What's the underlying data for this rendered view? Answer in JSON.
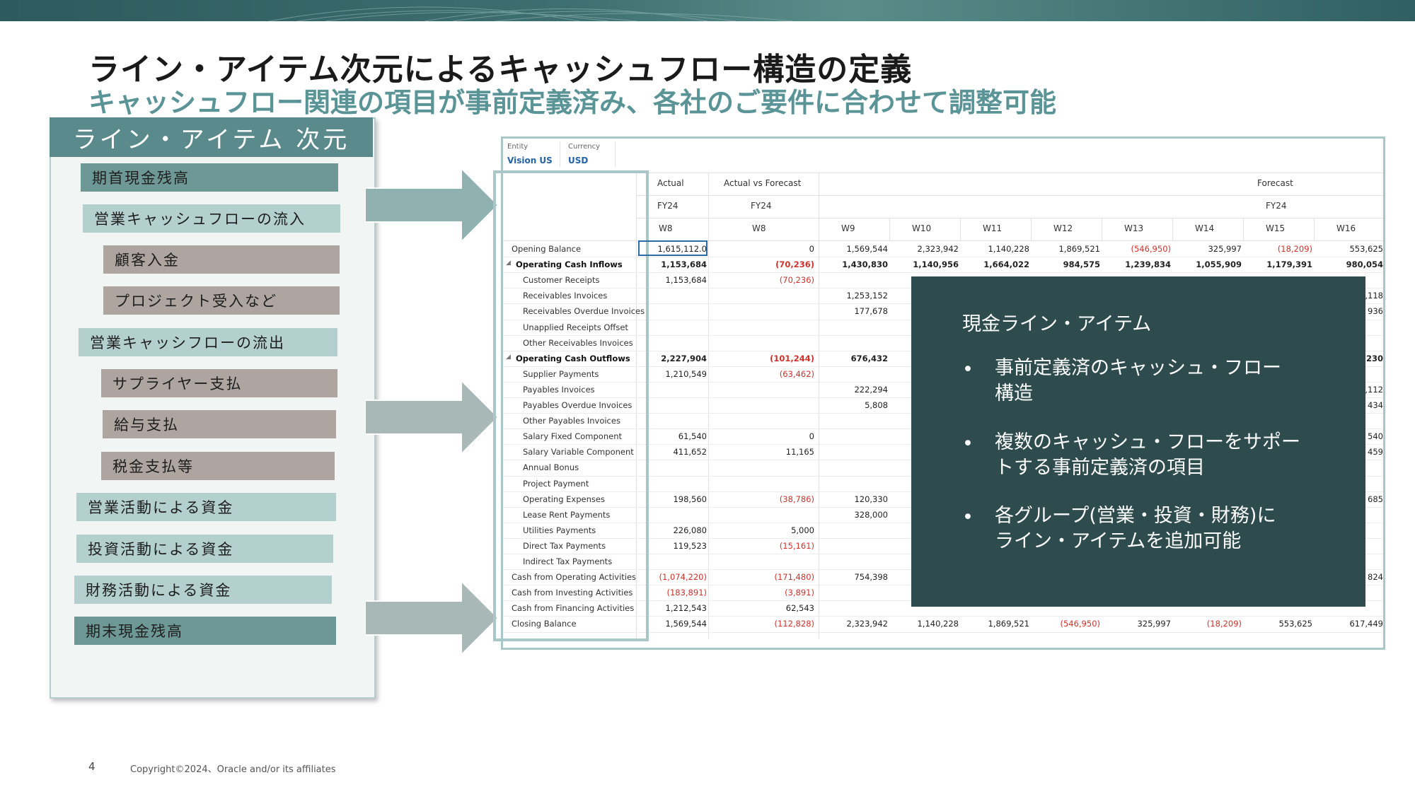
{
  "slide": {
    "title": "ライン・アイテム次元によるキャッシュフロー構造の定義",
    "subtitle": "キャッシュフロー関連の項目が事前定義済み、各社のご要件に合わせて調整可能",
    "page_number": "4",
    "copyright": "Copyright©2024、Oracle and/or its affiliates"
  },
  "left_panel": {
    "header": "ライン・アイテム 次元",
    "items": [
      "期首現金残高",
      "営業キャッシュフローの流入",
      "顧客入金",
      "プロジェクト受入など",
      "営業キャッシフローの流出",
      "サプライヤー支払",
      "給与支払",
      "税金支払等",
      "営業活動による資金",
      "投資活動による資金",
      "財務活動による資金",
      "期末現金残高"
    ]
  },
  "grid": {
    "pov": {
      "entity_label": "Entity",
      "entity_value": "Vision US",
      "currency_label": "Currency",
      "currency_value": "USD"
    },
    "header_row1": [
      "Actual",
      "Actual vs Forecast",
      "Forecast"
    ],
    "header_row2": [
      "FY24",
      "FY24",
      "FY24"
    ],
    "periods": [
      "W8",
      "W8",
      "W9",
      "W10",
      "W11",
      "W12",
      "W13",
      "W14",
      "W15",
      "W16"
    ],
    "rows": [
      {
        "label": "Opening Balance",
        "values": [
          "1,615,112.0",
          "0",
          "1,569,544",
          "2,323,942",
          "1,140,228",
          "1,869,521",
          "(546,950)",
          "325,997",
          "(18,209)",
          "553,625"
        ]
      },
      {
        "label": "Operating Cash Inflows",
        "values": [
          "1,153,684",
          "(70,236)",
          "1,430,830",
          "1,140,956",
          "1,664,022",
          "984,575",
          "1,239,834",
          "1,055,909",
          "1,179,391",
          "980,054"
        ]
      },
      {
        "label": "Customer Receipts",
        "values": [
          "1,153,684",
          "(70,236)",
          "",
          "",
          "",
          "",
          "",
          "",
          "",
          ""
        ]
      },
      {
        "label": "Receivables Invoices",
        "values": [
          "",
          "",
          "1,253,152",
          "",
          "",
          "",
          "",
          "",
          "",
          "1,118"
        ]
      },
      {
        "label": "Receivables Overdue Invoices",
        "values": [
          "",
          "",
          "177,678",
          "",
          "",
          "",
          "",
          "",
          "",
          "936"
        ]
      },
      {
        "label": "Unapplied Receipts Offset",
        "values": [
          "",
          "",
          "",
          "",
          "",
          "",
          "",
          "",
          "",
          ""
        ]
      },
      {
        "label": "Other Receivables Invoices",
        "values": [
          "",
          "",
          "",
          "",
          "",
          "",
          "",
          "",
          "",
          ""
        ]
      },
      {
        "label": "Operating Cash Outflows",
        "values": [
          "2,227,904",
          "(101,244)",
          "676,432",
          "",
          "",
          "",
          "",
          "",
          "",
          "230"
        ]
      },
      {
        "label": "Supplier Payments",
        "values": [
          "1,210,549",
          "(63,462)",
          "",
          "",
          "",
          "",
          "",
          "",
          "",
          ""
        ]
      },
      {
        "label": "Payables Invoices",
        "values": [
          "",
          "",
          "222,294",
          "",
          "",
          "",
          "",
          "",
          "",
          "5,112"
        ]
      },
      {
        "label": "Payables Overdue Invoices",
        "values": [
          "",
          "",
          "5,808",
          "",
          "",
          "",
          "",
          "",
          "",
          "434"
        ]
      },
      {
        "label": "Other Payables Invoices",
        "values": [
          "",
          "",
          "",
          "",
          "",
          "",
          "",
          "",
          "",
          ""
        ]
      },
      {
        "label": "Salary Fixed  Component",
        "values": [
          "61,540",
          "0",
          "",
          "",
          "",
          "",
          "",
          "",
          "",
          "540"
        ]
      },
      {
        "label": "Salary Variable Component",
        "values": [
          "411,652",
          "11,165",
          "",
          "",
          "",
          "",
          "",
          "",
          "",
          "459"
        ]
      },
      {
        "label": "Annual Bonus",
        "values": [
          "",
          "",
          "",
          "",
          "",
          "",
          "",
          "",
          "",
          ""
        ]
      },
      {
        "label": "Project Payment",
        "values": [
          "",
          "",
          "",
          "",
          "",
          "",
          "",
          "",
          "",
          ""
        ]
      },
      {
        "label": "Operating Expenses",
        "values": [
          "198,560",
          "(38,786)",
          "120,330",
          "",
          "",
          "",
          "",
          "",
          "",
          "685"
        ]
      },
      {
        "label": "Lease Rent Payments",
        "values": [
          "",
          "",
          "328,000",
          "",
          "",
          "",
          "",
          "",
          "",
          ""
        ]
      },
      {
        "label": "Utilities Payments",
        "values": [
          "226,080",
          "5,000",
          "",
          "",
          "",
          "",
          "",
          "",
          "",
          ""
        ]
      },
      {
        "label": "Direct Tax Payments",
        "values": [
          "119,523",
          "(15,161)",
          "",
          "",
          "",
          "",
          "",
          "",
          "",
          ""
        ]
      },
      {
        "label": "Indirect Tax Payments",
        "values": [
          "",
          "",
          "",
          "",
          "",
          "",
          "",
          "",
          "",
          ""
        ]
      },
      {
        "label": "Cash from Operating Activities",
        "values": [
          "(1,074,220)",
          "(171,480)",
          "754,398",
          "",
          "",
          "",
          "",
          "",
          "",
          "824"
        ]
      },
      {
        "label": "Cash from Investing Activities",
        "values": [
          "(183,891)",
          "(3,891)",
          "",
          "",
          "",
          "",
          "",
          "",
          "",
          ""
        ]
      },
      {
        "label": "Cash from Financing Activities",
        "values": [
          "1,212,543",
          "62,543",
          "",
          "",
          "",
          "",
          "",
          "",
          "",
          ""
        ]
      },
      {
        "label": "Closing Balance",
        "values": [
          "1,569,544",
          "(112,828)",
          "2,323,942",
          "1,140,228",
          "1,869,521",
          "(546,950)",
          "325,997",
          "(18,209)",
          "553,625",
          "617,449"
        ]
      }
    ]
  },
  "callout": {
    "title": "現金ライン・アイテム",
    "bullets": [
      [
        "事前定義済のキャッシュ・フロー",
        "構造"
      ],
      [
        "複数のキャッシュ・フローをサポー",
        "トする事前定義済の項目"
      ],
      [
        "各グループ(営業・投資・財務)に",
        "ライン・アイテムを追加可能"
      ]
    ],
    "bullet_char": "•"
  },
  "colors": {
    "accent_dark": "#6e9896",
    "accent_light": "#b3d0cf",
    "gray_item": "#aea5a1",
    "callout_bg": "#2e4b4d",
    "negative": "#d0302a"
  }
}
